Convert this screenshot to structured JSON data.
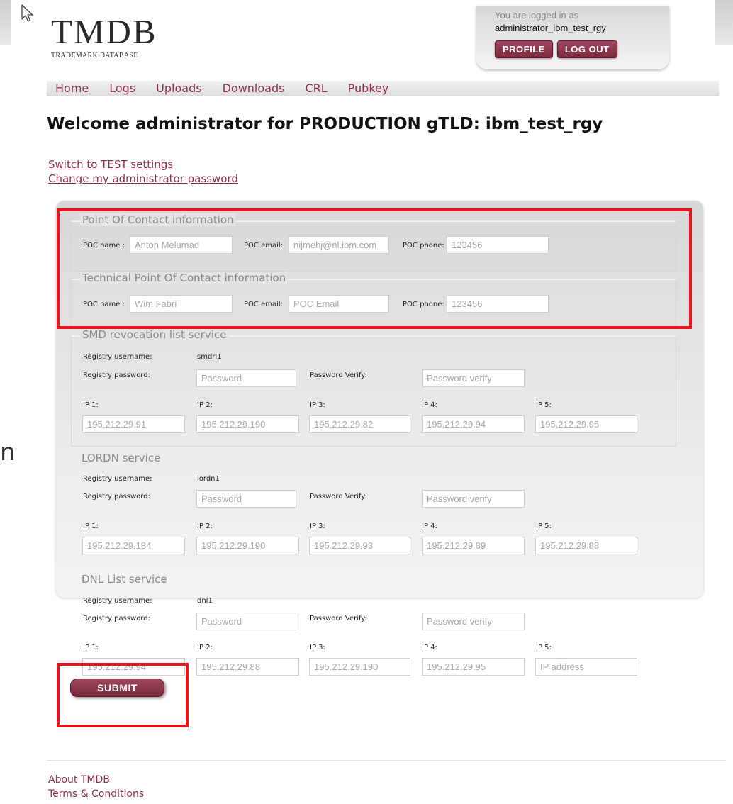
{
  "side_glyph": "n",
  "header": {
    "logo_title": "TMDB",
    "logo_subtitle": "TRADEMARK DATABASE",
    "logged_in_label": "You are logged in as",
    "username": "administrator_ibm_test_rgy",
    "profile_button": "PROFILE",
    "logout_button": "LOG OUT"
  },
  "nav": [
    "Home",
    "Logs",
    "Uploads",
    "Downloads",
    "CRL",
    "Pubkey"
  ],
  "page_title": "Welcome administrator for PRODUCTION gTLD: ibm_test_rgy",
  "links": {
    "switch_settings": "Switch to TEST settings",
    "change_password": "Change my administrator password"
  },
  "poc": {
    "legend": "Point Of Contact information",
    "name_label": "POC name :",
    "name_value": "Anton Melumad",
    "email_label": "POC email:",
    "email_value": "nijmehj@nl.ibm.com",
    "phone_label": "POC phone:",
    "phone_value": "123456"
  },
  "tech_poc": {
    "legend": "Technical Point Of Contact information",
    "name_label": "POC name :",
    "name_value": "Wim Fabri",
    "email_label": "POC email:",
    "email_value": "POC Email",
    "phone_label": "POC phone:",
    "phone_value": "123456"
  },
  "labels": {
    "registry_username": "Registry username:",
    "registry_password": "Registry password:",
    "password_verify": "Password Verify:",
    "password_placeholder": "Password",
    "verify_placeholder": "Password verify",
    "ip1": "IP 1:",
    "ip2": "IP 2:",
    "ip3": "IP 3:",
    "ip4": "IP 4:",
    "ip5": "IP 5:"
  },
  "services": [
    {
      "legend": "SMD revocation list service",
      "username": "smdrl1",
      "ips": [
        "195.212.29.91",
        "195.212.29.190",
        "195.212.29.82",
        "195.212.29.94",
        "195.212.29.95"
      ]
    },
    {
      "legend": "LORDN service",
      "username": "lordn1",
      "ips": [
        "195.212.29.184",
        "195.212.29.190",
        "195.212.29.93",
        "195.212.29.89",
        "195.212.29.88"
      ]
    },
    {
      "legend": "DNL List service",
      "username": "dnl1",
      "ips": [
        "195.212.29.94",
        "195.212.29.88",
        "195.212.29.190",
        "195.212.29.95",
        "IP address"
      ]
    }
  ],
  "submit_button": "SUBMIT",
  "footer": {
    "about": "About TMDB",
    "terms": "Terms & Conditions"
  },
  "colors": {
    "accent": "#8e3346",
    "button": "#8a3348",
    "highlight": "#e8141c"
  }
}
